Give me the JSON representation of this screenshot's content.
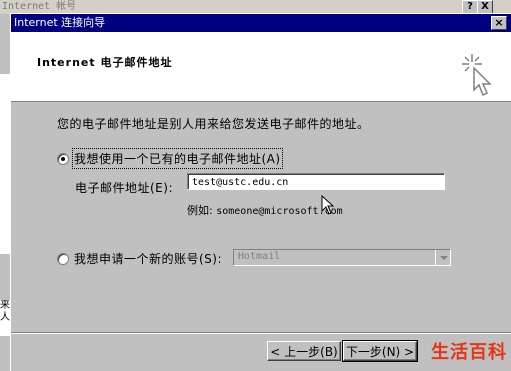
{
  "background": {
    "title": "Internet 帐号",
    "help_glyph": "?",
    "close_glyph": "X",
    "side_text": "来人"
  },
  "dialog": {
    "title": "Internet 连接向导",
    "close_glyph": "×",
    "heading": "Internet 电子邮件地址",
    "intro": "您的电子邮件地址是别人用来给您发送电子邮件的地址。",
    "option_existing": {
      "label": "我想使用一个已有的电子邮件地址(A)",
      "checked": true
    },
    "email_label": "电子邮件地址(E):",
    "email_value": "test@ustc.edu.cn",
    "example_prefix": "例如:",
    "example_value": "someone@microsoft.com",
    "option_new": {
      "label": "我想申请一个新的账号(S):",
      "checked": false
    },
    "provider_select": {
      "value": "Hotmail",
      "disabled": true
    },
    "buttons": {
      "back": "< 上一步(B)",
      "next": "下一步(N) >"
    }
  },
  "watermark": "生活百科",
  "colors": {
    "title_bar": "#000080",
    "face": "#c0c0c0",
    "watermark": "#e53617"
  }
}
